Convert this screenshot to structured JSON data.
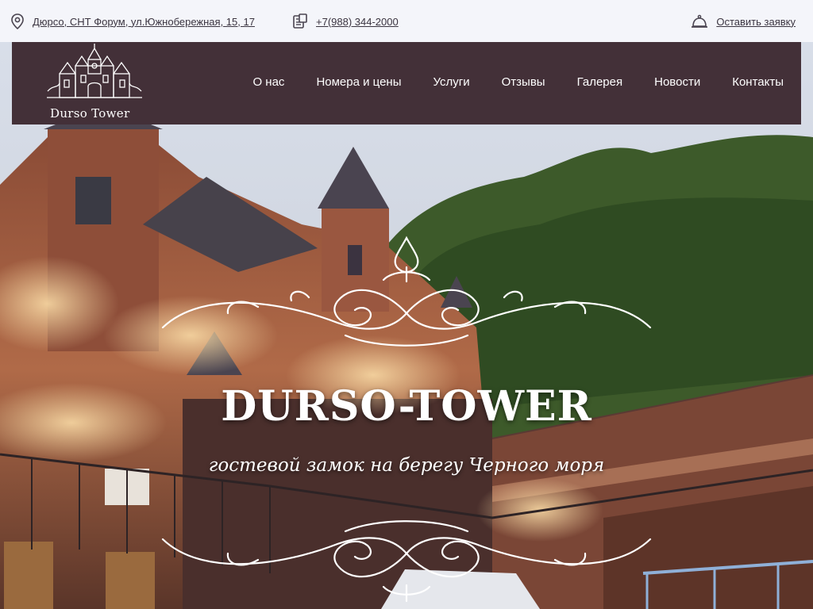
{
  "topbar": {
    "address": "Дюрсо, СНТ Форум, ул.Южнобережная, 15, 17",
    "phone": "+7(988) 344-2000",
    "request": "Оставить заявку"
  },
  "logo": {
    "text": "Durso Tower"
  },
  "nav": {
    "items": [
      "О нас",
      "Номера и цены",
      "Услуги",
      "Отзывы",
      "Галерея",
      "Новости",
      "Контакты"
    ]
  },
  "hero": {
    "title": "DURSO-TOWER",
    "subtitle": "гостевой замок на берегу Черного моря"
  },
  "colors": {
    "nav_bg": "#433038",
    "topbar_bg": "#f4f5fa",
    "text": "#3a3440"
  },
  "icons": {
    "address": "map-pin-icon",
    "phone": "phone-icon",
    "request": "bell-icon"
  }
}
